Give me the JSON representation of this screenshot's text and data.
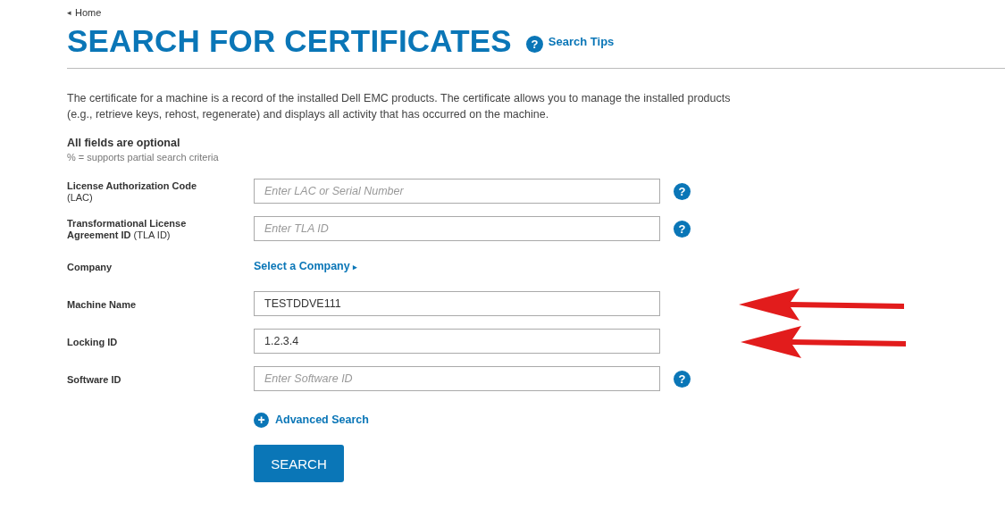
{
  "breadcrumb": {
    "icon": "◂",
    "label": "Home"
  },
  "title": "SEARCH FOR CERTIFICATES",
  "tips": {
    "icon": "?",
    "label": "Search Tips"
  },
  "intro": "The certificate for a machine is a record of the installed Dell EMC products. The certificate allows you to manage the installed products (e.g., retrieve keys, rehost, regenerate) and displays all activity that has occurred on the machine.",
  "optional_heading": "All fields are optional",
  "optional_note": "% = supports partial search criteria",
  "fields": [
    {
      "kind": "input",
      "label": "License Authorization Code",
      "label_note": "(LAC)",
      "placeholder": "Enter LAC or Serial Number",
      "help": "?",
      "annotated": false
    },
    {
      "kind": "input",
      "label": "Transformational License Agreement ID",
      "label_note": "(TLA ID)",
      "placeholder": "Enter TLA ID",
      "help": "?",
      "annotated": false
    },
    {
      "kind": "link",
      "label": "Company",
      "link": "Select a Company",
      "link_icon": "▸",
      "annotated": false
    },
    {
      "kind": "input",
      "label": "Machine Name",
      "value": "TESTDDVE111",
      "annotated": true
    },
    {
      "kind": "input",
      "label": "Locking ID",
      "value": "1.2.3.4",
      "annotated": true
    },
    {
      "kind": "input",
      "label": "Software ID",
      "placeholder": "Enter Software ID",
      "help": "?",
      "annotated": false
    }
  ],
  "advanced": {
    "icon": "+",
    "label": "Advanced Search"
  },
  "submit": "SEARCH"
}
